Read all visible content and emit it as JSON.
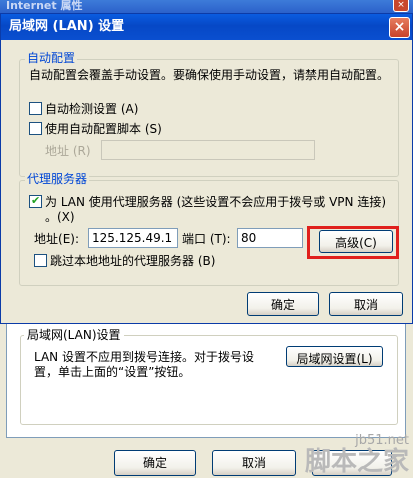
{
  "background_window": {
    "title": "Internet 属性",
    "lan_group_title": "局域网(LAN)设置",
    "lan_text": "LAN 设置不应用到拨号连接。对于拨号设置，单击上面的“设置”按钮。",
    "lan_button": "局域网设置(L)",
    "ok": "确定",
    "cancel": "取消"
  },
  "dialog": {
    "title": "局域网 (LAN) 设置",
    "close_symbol": "×",
    "auto_config": {
      "legend": "自动配置",
      "description": "自动配置会覆盖手动设置。要确保使用手动设置，请禁用自动配置。",
      "auto_detect": {
        "label": "自动检测设置",
        "key": "(A)",
        "checked": false
      },
      "use_script": {
        "label": "使用自动配置脚本",
        "key": "(S)",
        "checked": false
      },
      "address_label": "地址",
      "address_key": "(R)",
      "address_value": ""
    },
    "proxy": {
      "legend": "代理服务器",
      "use_proxy": {
        "label_line1": "为 LAN 使用代理服务器 (这些设置不会应用于拨号或 VPN 连接)",
        "label_line2": "。(X)",
        "checked": true
      },
      "address_label": "地址",
      "address_key": "(E):",
      "address_value": "125.125.49.1",
      "port_label": "端口",
      "port_key": "(T):",
      "port_value": "80",
      "advanced_button": "高级(C)",
      "bypass_local": {
        "label": "跳过本地地址的代理服务器",
        "key": "(B)",
        "checked": false
      }
    },
    "ok_button": "确定",
    "cancel_button": "取消"
  },
  "watermark": {
    "url": "jb51.net",
    "brand": "脚本之家"
  },
  "colors": {
    "titlebar_blue": "#0a5ce0",
    "highlight_red": "#e0201c",
    "group_legend_blue": "#0046d5"
  }
}
